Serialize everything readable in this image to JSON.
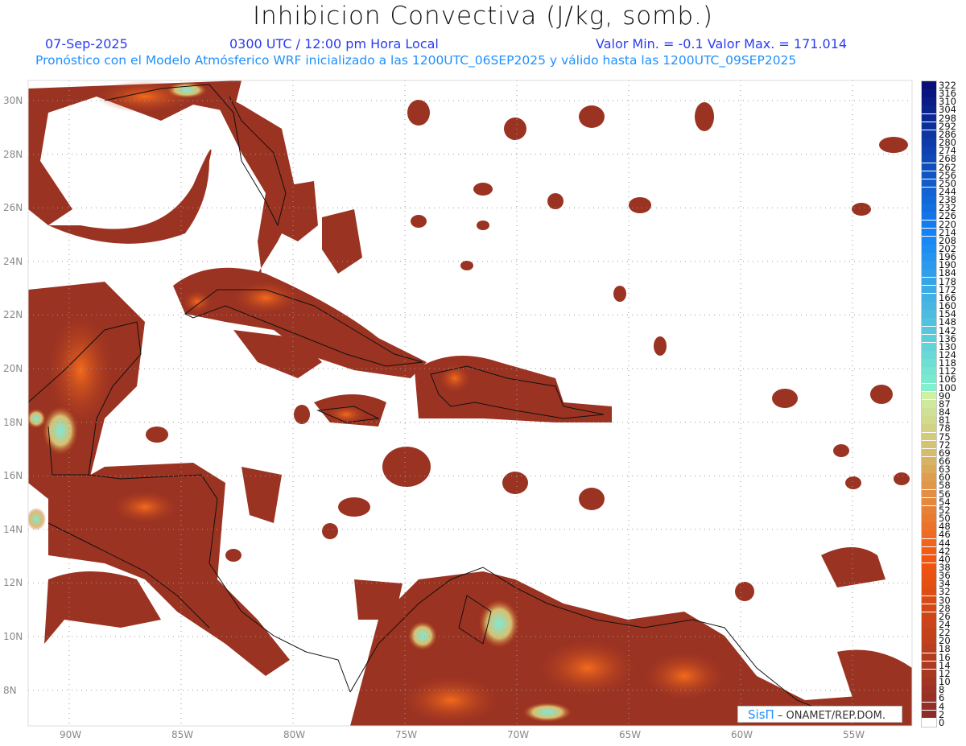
{
  "header": {
    "title": "Inhibicion Convectiva (J/kg, somb.)",
    "date": "07-Sep-2025",
    "time": "0300 UTC / 12:00 pm Hora Local",
    "minmax": "Valor Min. = -0.1  Valor Max. = 171.014",
    "forecast_info": "Pronóstico con el Modelo Atmósferico WRF inicializado a las 1200UTC_06SEP2025 y válido hasta las  1200UTC_09SEP2025"
  },
  "map": {
    "lon_labels": [
      "90W",
      "85W",
      "80W",
      "75W",
      "70W",
      "65W",
      "60W",
      "55W"
    ],
    "lat_labels": [
      "30N",
      "28N",
      "26N",
      "24N",
      "22N",
      "20N",
      "18N",
      "16N",
      "14N",
      "12N",
      "10N",
      "8N"
    ],
    "fill_color": "#9b3322"
  },
  "colorbar": {
    "labels": [
      "322",
      "316",
      "310",
      "304",
      "298",
      "292",
      "286",
      "280",
      "274",
      "268",
      "262",
      "256",
      "250",
      "244",
      "238",
      "232",
      "226",
      "220",
      "214",
      "208",
      "202",
      "196",
      "190",
      "184",
      "178",
      "172",
      "166",
      "160",
      "154",
      "148",
      "142",
      "136",
      "130",
      "124",
      "118",
      "112",
      "106",
      "100",
      "90",
      "87",
      "84",
      "81",
      "78",
      "75",
      "72",
      "69",
      "66",
      "63",
      "60",
      "58",
      "56",
      "54",
      "52",
      "50",
      "48",
      "46",
      "44",
      "42",
      "40",
      "38",
      "36",
      "34",
      "32",
      "30",
      "28",
      "26",
      "24",
      "22",
      "20",
      "18",
      "16",
      "14",
      "12",
      "10",
      "8",
      "6",
      "4",
      "2",
      "0"
    ]
  },
  "credit": {
    "brand": "SisΠ",
    "text": " –  ONAMET/REP.DOM."
  }
}
